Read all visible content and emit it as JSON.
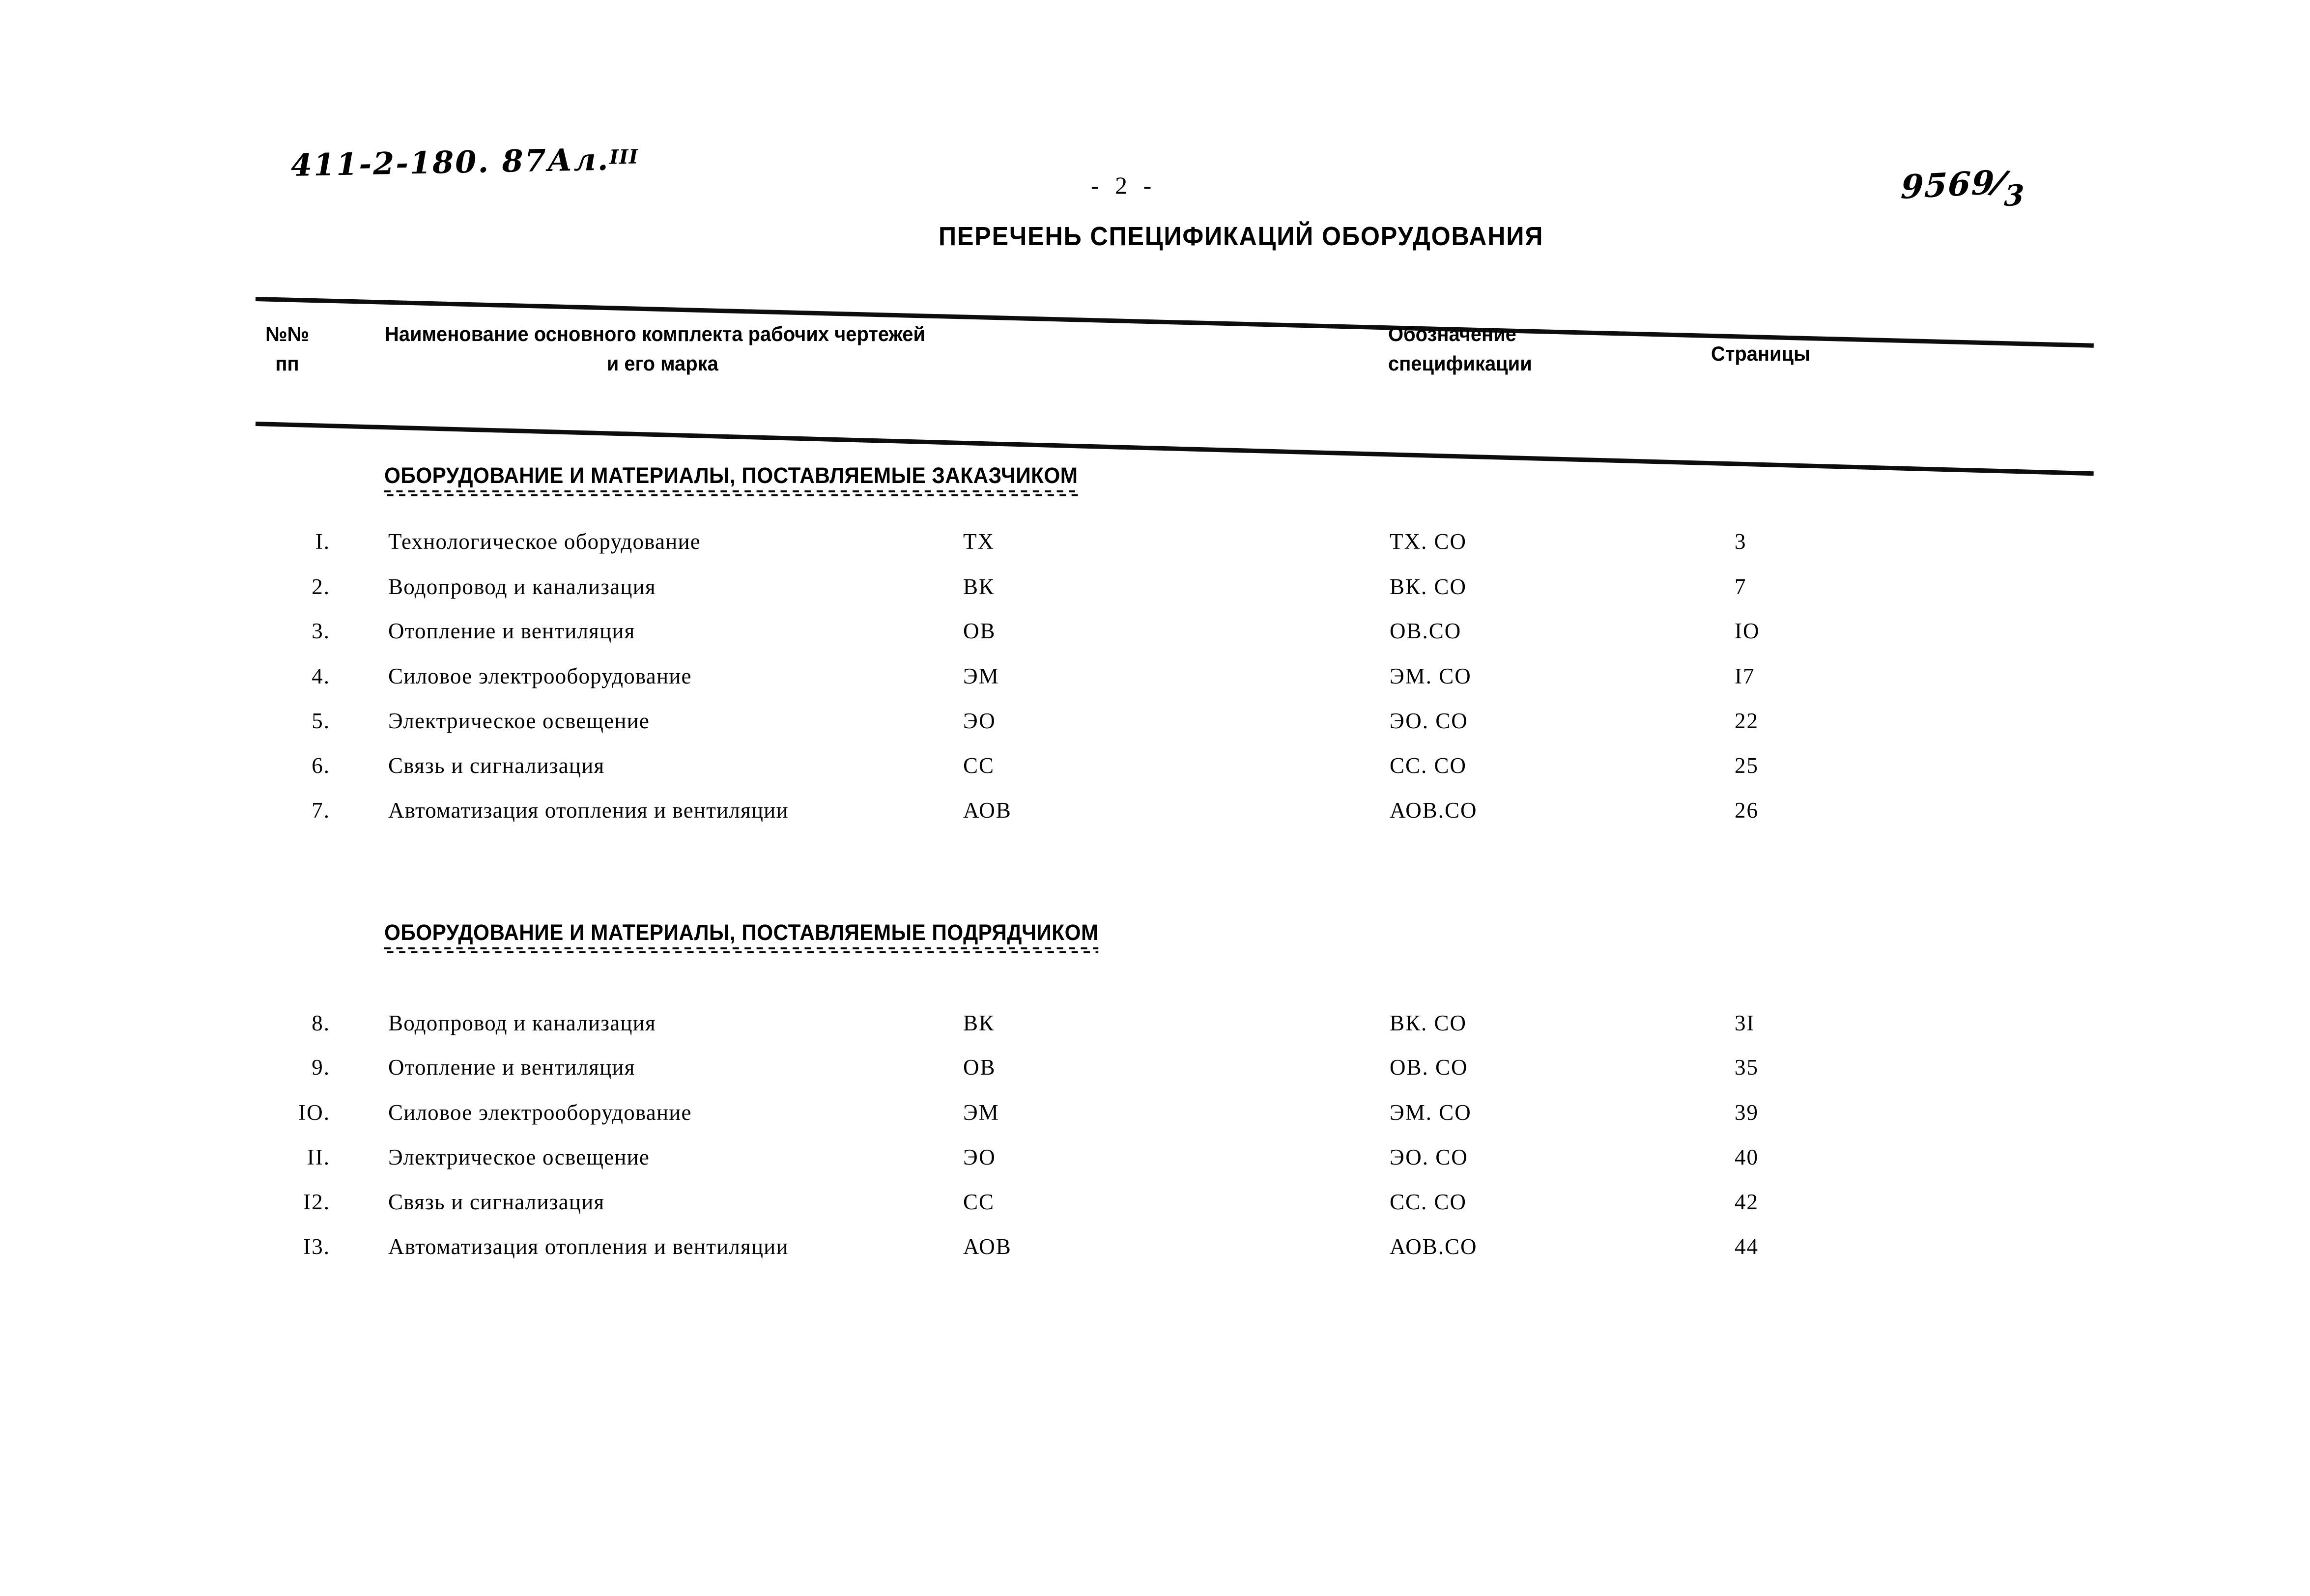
{
  "annotations": {
    "doc_code": "411-2-180. 87Ал.",
    "doc_code_suffix": "III",
    "archive_stamp_numerator": "9569",
    "archive_stamp_denominator": "3"
  },
  "page_number": "- 2 -",
  "doc_title": "ПЕРЕЧЕНЬ СПЕЦИФИКАЦИЙ  ОБОРУДОВАНИЯ",
  "table_header": {
    "num_line1": "№№",
    "num_line2": "пп",
    "name_line1": "Наименование основного комплекта рабочих чертежей",
    "name_line2": "и его марка",
    "spec_line1": "Обозначение",
    "spec_line2": "спецификации",
    "pages": "Страницы"
  },
  "sections": [
    {
      "heading": "ОБОРУДОВАНИЕ  И  МАТЕРИАЛЫ, ПОСТАВЛЯЕМЫЕ  ЗАКАЗЧИКОМ",
      "rows": [
        {
          "num": "I.",
          "name": "Технологическое оборудование",
          "mark": "ТХ",
          "spec": "ТХ. СО",
          "page": "3"
        },
        {
          "num": "2.",
          "name": "Водопровод и канализация",
          "mark": "ВК",
          "spec": "ВК. СО",
          "page": "7"
        },
        {
          "num": "3.",
          "name": "Отопление и вентиляция",
          "mark": "ОВ",
          "spec": "ОВ.СО",
          "page": "IO"
        },
        {
          "num": "4.",
          "name": "Силовое электрооборудование",
          "mark": "ЭМ",
          "spec": "ЭМ. СО",
          "page": "I7"
        },
        {
          "num": "5.",
          "name": "Электрическое освещение",
          "mark": "ЭО",
          "spec": "ЭО. СО",
          "page": "22"
        },
        {
          "num": "6.",
          "name": "Связь и сигнализация",
          "mark": "СС",
          "spec": "СС. СО",
          "page": "25"
        },
        {
          "num": "7.",
          "name": "Автоматизация отопления и вентиляции",
          "mark": "АОВ",
          "spec": "АОВ.СО",
          "page": "26"
        }
      ]
    },
    {
      "heading": "ОБОРУДОВАНИЕ  И  МАТЕРИАЛЫ, ПОСТАВЛЯЕМЫЕ  ПОДРЯДЧИКОМ",
      "rows": [
        {
          "num": "8.",
          "name": "Водопровод и канализация",
          "mark": "ВК",
          "spec": "ВК. СО",
          "page": "3I"
        },
        {
          "num": "9.",
          "name": "Отопление и вентиляция",
          "mark": "ОВ",
          "spec": "ОВ. СО",
          "page": "35"
        },
        {
          "num": "IO.",
          "name": "Силовое электрооборудование",
          "mark": "ЭМ",
          "spec": "ЭМ. СО",
          "page": "39"
        },
        {
          "num": "II.",
          "name": "Электрическое освещение",
          "mark": "ЭО",
          "spec": "ЭО. СО",
          "page": "40"
        },
        {
          "num": "I2.",
          "name": "Связь и сигнализация",
          "mark": "СС",
          "spec": "СС. СО",
          "page": "42"
        },
        {
          "num": "I3.",
          "name": "Автоматизация отопления и вентиляции",
          "mark": "АОВ",
          "spec": "АОВ.СО",
          "page": "44"
        }
      ]
    }
  ],
  "layout": {
    "section1_row_tops": [
      1076,
      1168,
      1258,
      1350,
      1441,
      1532,
      1623
    ],
    "section2_row_tops": [
      2056,
      2146,
      2238,
      2329,
      2420,
      2511
    ]
  }
}
